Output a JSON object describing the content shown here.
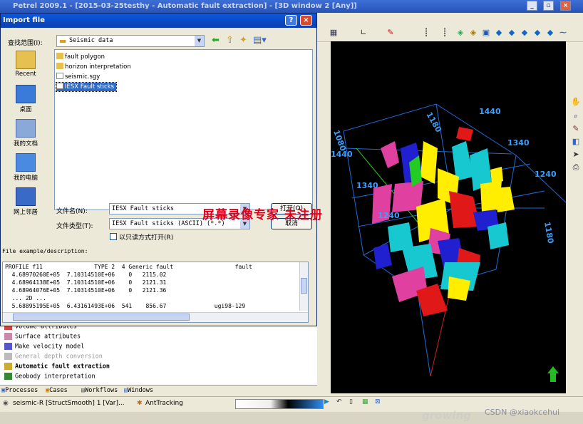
{
  "app": {
    "title": "Petrel 2009.1 - [2015-03-25testhy - Automatic fault extraction] - [3D window 2 [Any]]",
    "minimize": "_",
    "restore": "▫",
    "close": "×"
  },
  "dialog": {
    "title": "Import file",
    "help_button": "?",
    "close_button": "×",
    "lookin_label": "查找范围(I):",
    "lookin_value": "Seismic data",
    "places": [
      {
        "label": "Recent"
      },
      {
        "label": "桌面"
      },
      {
        "label": "我的文档"
      },
      {
        "label": "我的电脑"
      },
      {
        "label": "网上邻居"
      }
    ],
    "files": [
      {
        "name": "fault polygon",
        "type": "folder"
      },
      {
        "name": "horizon interpretation",
        "type": "folder"
      },
      {
        "name": "seismic.sgy",
        "type": "file"
      },
      {
        "name": "IESX Fault sticks",
        "type": "file"
      }
    ],
    "filename_label": "文件名(N):",
    "filename_value": "IESX Fault sticks",
    "filetype_label": "文件类型(T):",
    "filetype_value": "IESX Fault sticks (ASCII) (*.*)",
    "readonly_label": "以只读方式打开(R)",
    "open_button": "打开(O)",
    "cancel_button": "取消",
    "description_label": "File example/description:",
    "description_lines": [
      "PROFILE f11               TYPE 2  4 Generic fault                  fault",
      "  4.68970260E+05  7.10314510E+06    0   2115.02",
      "  4.68964138E+05  7.10314510E+06    0   2121.31",
      "  4.68964076E+05  7.10314510E+06    0   2121.36",
      "  ... 2D ...",
      "  5.68895195E+05  6.43161493E+06  541    856.67              ugi98-129"
    ]
  },
  "processes": [
    {
      "label": "Volume attributes"
    },
    {
      "label": "Surface attributes"
    },
    {
      "label": "Make velocity model"
    },
    {
      "label": "General depth conversion"
    },
    {
      "label": "Automatic fault extraction"
    },
    {
      "label": "Geobody interpretation"
    }
  ],
  "tabs": [
    {
      "label": "Processes"
    },
    {
      "label": "Cases"
    },
    {
      "label": "Workflows"
    },
    {
      "label": "Windows"
    }
  ],
  "status": {
    "seismic": "seismic-R [StructSmooth] 1 [Var]...",
    "ant": "AntTracking"
  },
  "viewport": {
    "axis_labels": [
      "1180",
      "1440",
      "1080",
      "1440",
      "1340",
      "1340",
      "1240",
      "1240",
      "1180"
    ]
  },
  "watermark": "屏幕录像专家 未注册",
  "csdn": "CSDN @xiaokcehui",
  "growing": "growing"
}
